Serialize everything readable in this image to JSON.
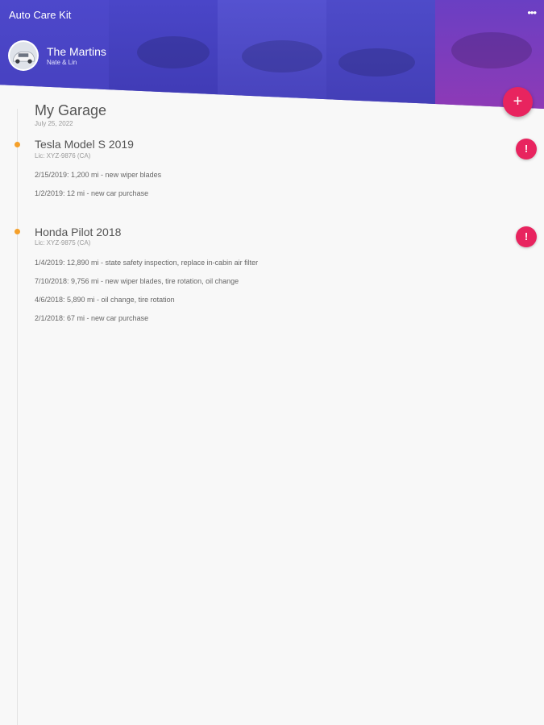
{
  "app": {
    "title": "Auto Care Kit",
    "menu_icon": "more-horizontal-icon"
  },
  "profile": {
    "name": "The Martins",
    "subtitle": "Nate & Lin"
  },
  "add_button": {
    "label": "+"
  },
  "garage": {
    "title": "My Garage",
    "date": "July 25, 2022"
  },
  "cars": [
    {
      "title": "Tesla Model S 2019",
      "license": "Lic: XYZ-9876 (CA)",
      "alert_label": "!",
      "entries": [
        "2/15/2019: 1,200 mi - new wiper blades",
        "1/2/2019: 12 mi - new car purchase"
      ]
    },
    {
      "title": "Honda Pilot 2018",
      "license": "Lic: XYZ-9875 (CA)",
      "alert_label": "!",
      "entries": [
        "1/4/2019: 12,890 mi - state safety inspection, replace in-cabin air filter",
        "7/10/2018: 9,756 mi - new wiper blades, tire rotation, oil change",
        "4/6/2018: 5,890 mi - oil change, tire rotation",
        "2/1/2018: 67 mi - new car purchase"
      ]
    }
  ],
  "colors": {
    "header": "#4e46c9",
    "accent": "#e8245f",
    "timeline_dot": "#f5a02a"
  }
}
